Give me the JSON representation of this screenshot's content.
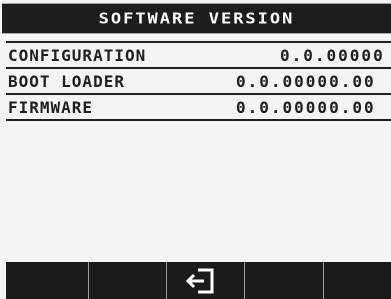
{
  "header": {
    "title": "SOFTWARE VERSION"
  },
  "rows": [
    {
      "label": "CONFIGURATION",
      "value": "0.0.00000"
    },
    {
      "label": "BOOT LOADER",
      "value": "0.0.00000.00"
    },
    {
      "label": "FIRMWARE",
      "value": "0.0.00000.00"
    }
  ],
  "softkeys": [
    {
      "icon": ""
    },
    {
      "icon": ""
    },
    {
      "icon": "exit-icon"
    },
    {
      "icon": ""
    },
    {
      "icon": ""
    }
  ],
  "colors": {
    "header_bg": "#1d1d1d",
    "screen_bg": "#f4f4f4",
    "text": "#1f1f1f",
    "footer_bg": "#1b1b1b"
  }
}
